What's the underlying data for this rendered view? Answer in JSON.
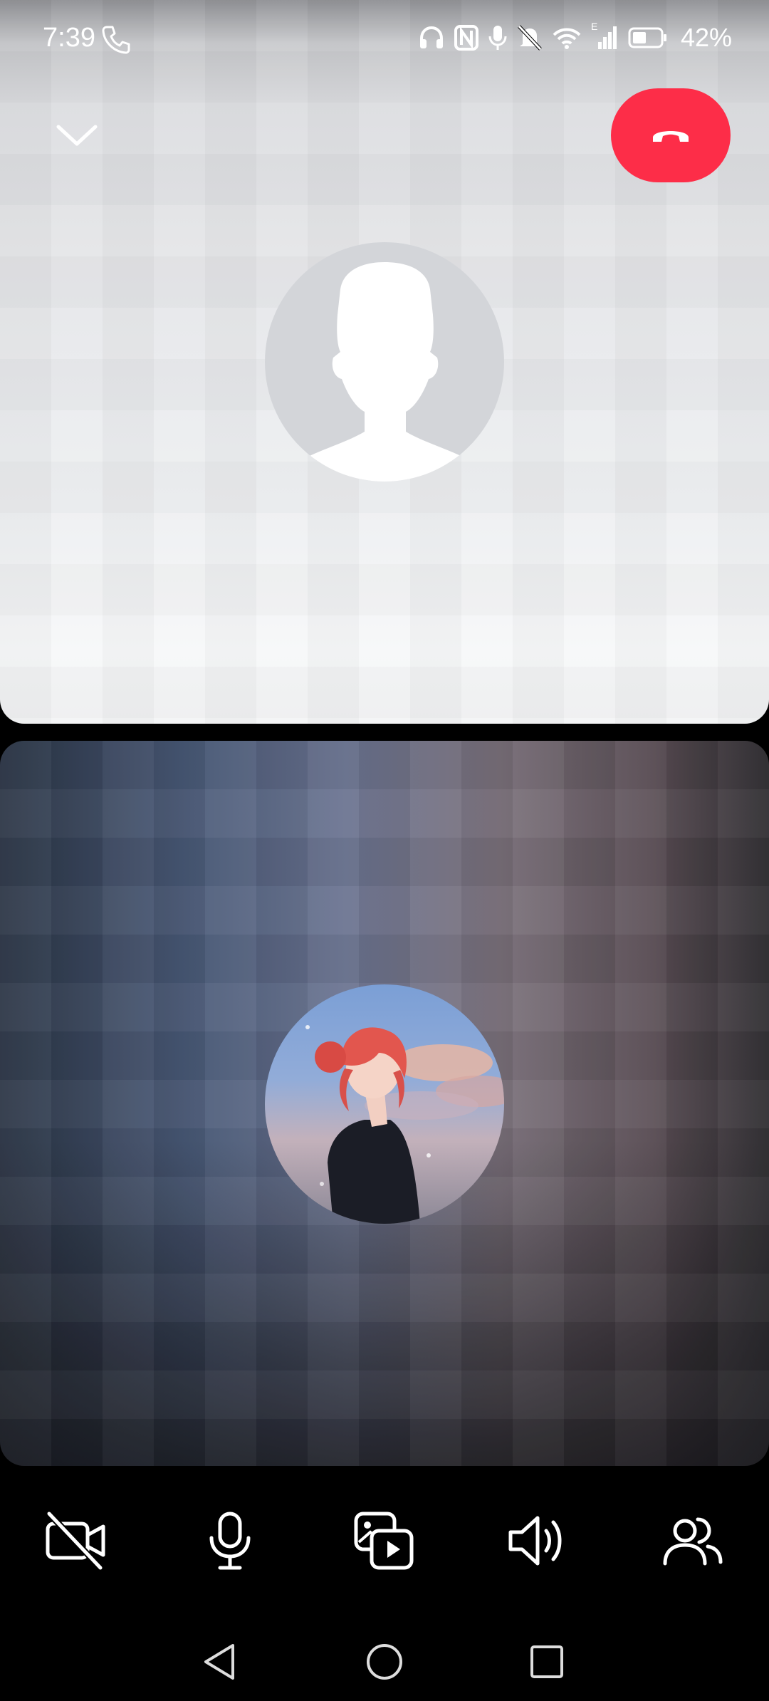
{
  "status_bar": {
    "time": "7:39",
    "battery_percent": "42%",
    "network_label": "E",
    "icons": [
      "call-icon",
      "headphones-icon",
      "nfc-icon",
      "mic-icon",
      "bell-muted-icon",
      "wifi-icon",
      "signal-icon",
      "battery-icon"
    ]
  },
  "call_header": {
    "collapse_icon": "chevron-down-icon",
    "end_call_icon": "phone-hangup-icon",
    "end_call_color": "#fd2d48"
  },
  "participants": [
    {
      "role": "remote",
      "avatar": "default-silhouette-avatar"
    },
    {
      "role": "self",
      "avatar": "anime-girl-profile-photo"
    }
  ],
  "controls": [
    {
      "name": "camera-off-button",
      "icon": "video-off-icon"
    },
    {
      "name": "microphone-button",
      "icon": "mic-icon"
    },
    {
      "name": "share-media-button",
      "icon": "media-share-icon"
    },
    {
      "name": "speaker-button",
      "icon": "speaker-icon"
    },
    {
      "name": "add-people-button",
      "icon": "people-icon"
    }
  ],
  "nav_bar": [
    "back-icon",
    "home-icon",
    "recents-icon"
  ]
}
